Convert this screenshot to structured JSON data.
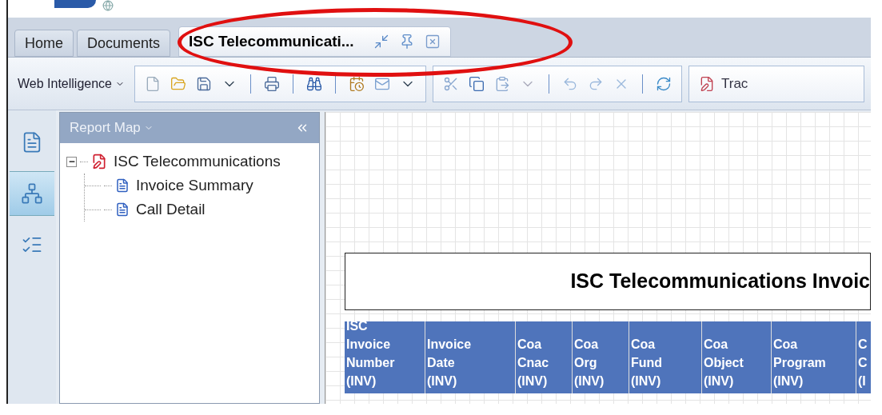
{
  "tabs": [
    {
      "label": "Home",
      "selected": false
    },
    {
      "label": "Documents",
      "selected": false
    },
    {
      "label": "ISC Telecommunicati...",
      "selected": true
    }
  ],
  "toolbar": {
    "app_menu": "Web Intelligence",
    "track_label": "Trac"
  },
  "side_strip": [
    {
      "kind": "document",
      "selected": false
    },
    {
      "kind": "tree",
      "selected": true
    },
    {
      "kind": "checklist",
      "selected": false
    }
  ],
  "report_map": {
    "title": "Report Map",
    "tree": [
      {
        "label": "ISC Telecommunications",
        "expanded": true,
        "children": [
          {
            "label": "Invoice Summary"
          },
          {
            "label": "Call Detail"
          }
        ]
      }
    ]
  },
  "report": {
    "title": "ISC Telecommunications Invoic",
    "columns": [
      {
        "lines": [
          "ISC",
          "Invoice",
          "Number",
          "(INV)"
        ]
      },
      {
        "lines": [
          "Invoice",
          "Date",
          "(INV)"
        ]
      },
      {
        "lines": [
          "Coa",
          "Cnac",
          "(INV)"
        ]
      },
      {
        "lines": [
          "Coa",
          "Org",
          "(INV)"
        ]
      },
      {
        "lines": [
          "Coa",
          "Fund",
          "(INV)"
        ]
      },
      {
        "lines": [
          "Coa",
          "Object",
          "(INV)"
        ]
      },
      {
        "lines": [
          "Coa",
          "Program",
          "(INV)"
        ]
      },
      {
        "lines": [
          "C",
          "C",
          "(I"
        ]
      }
    ]
  }
}
